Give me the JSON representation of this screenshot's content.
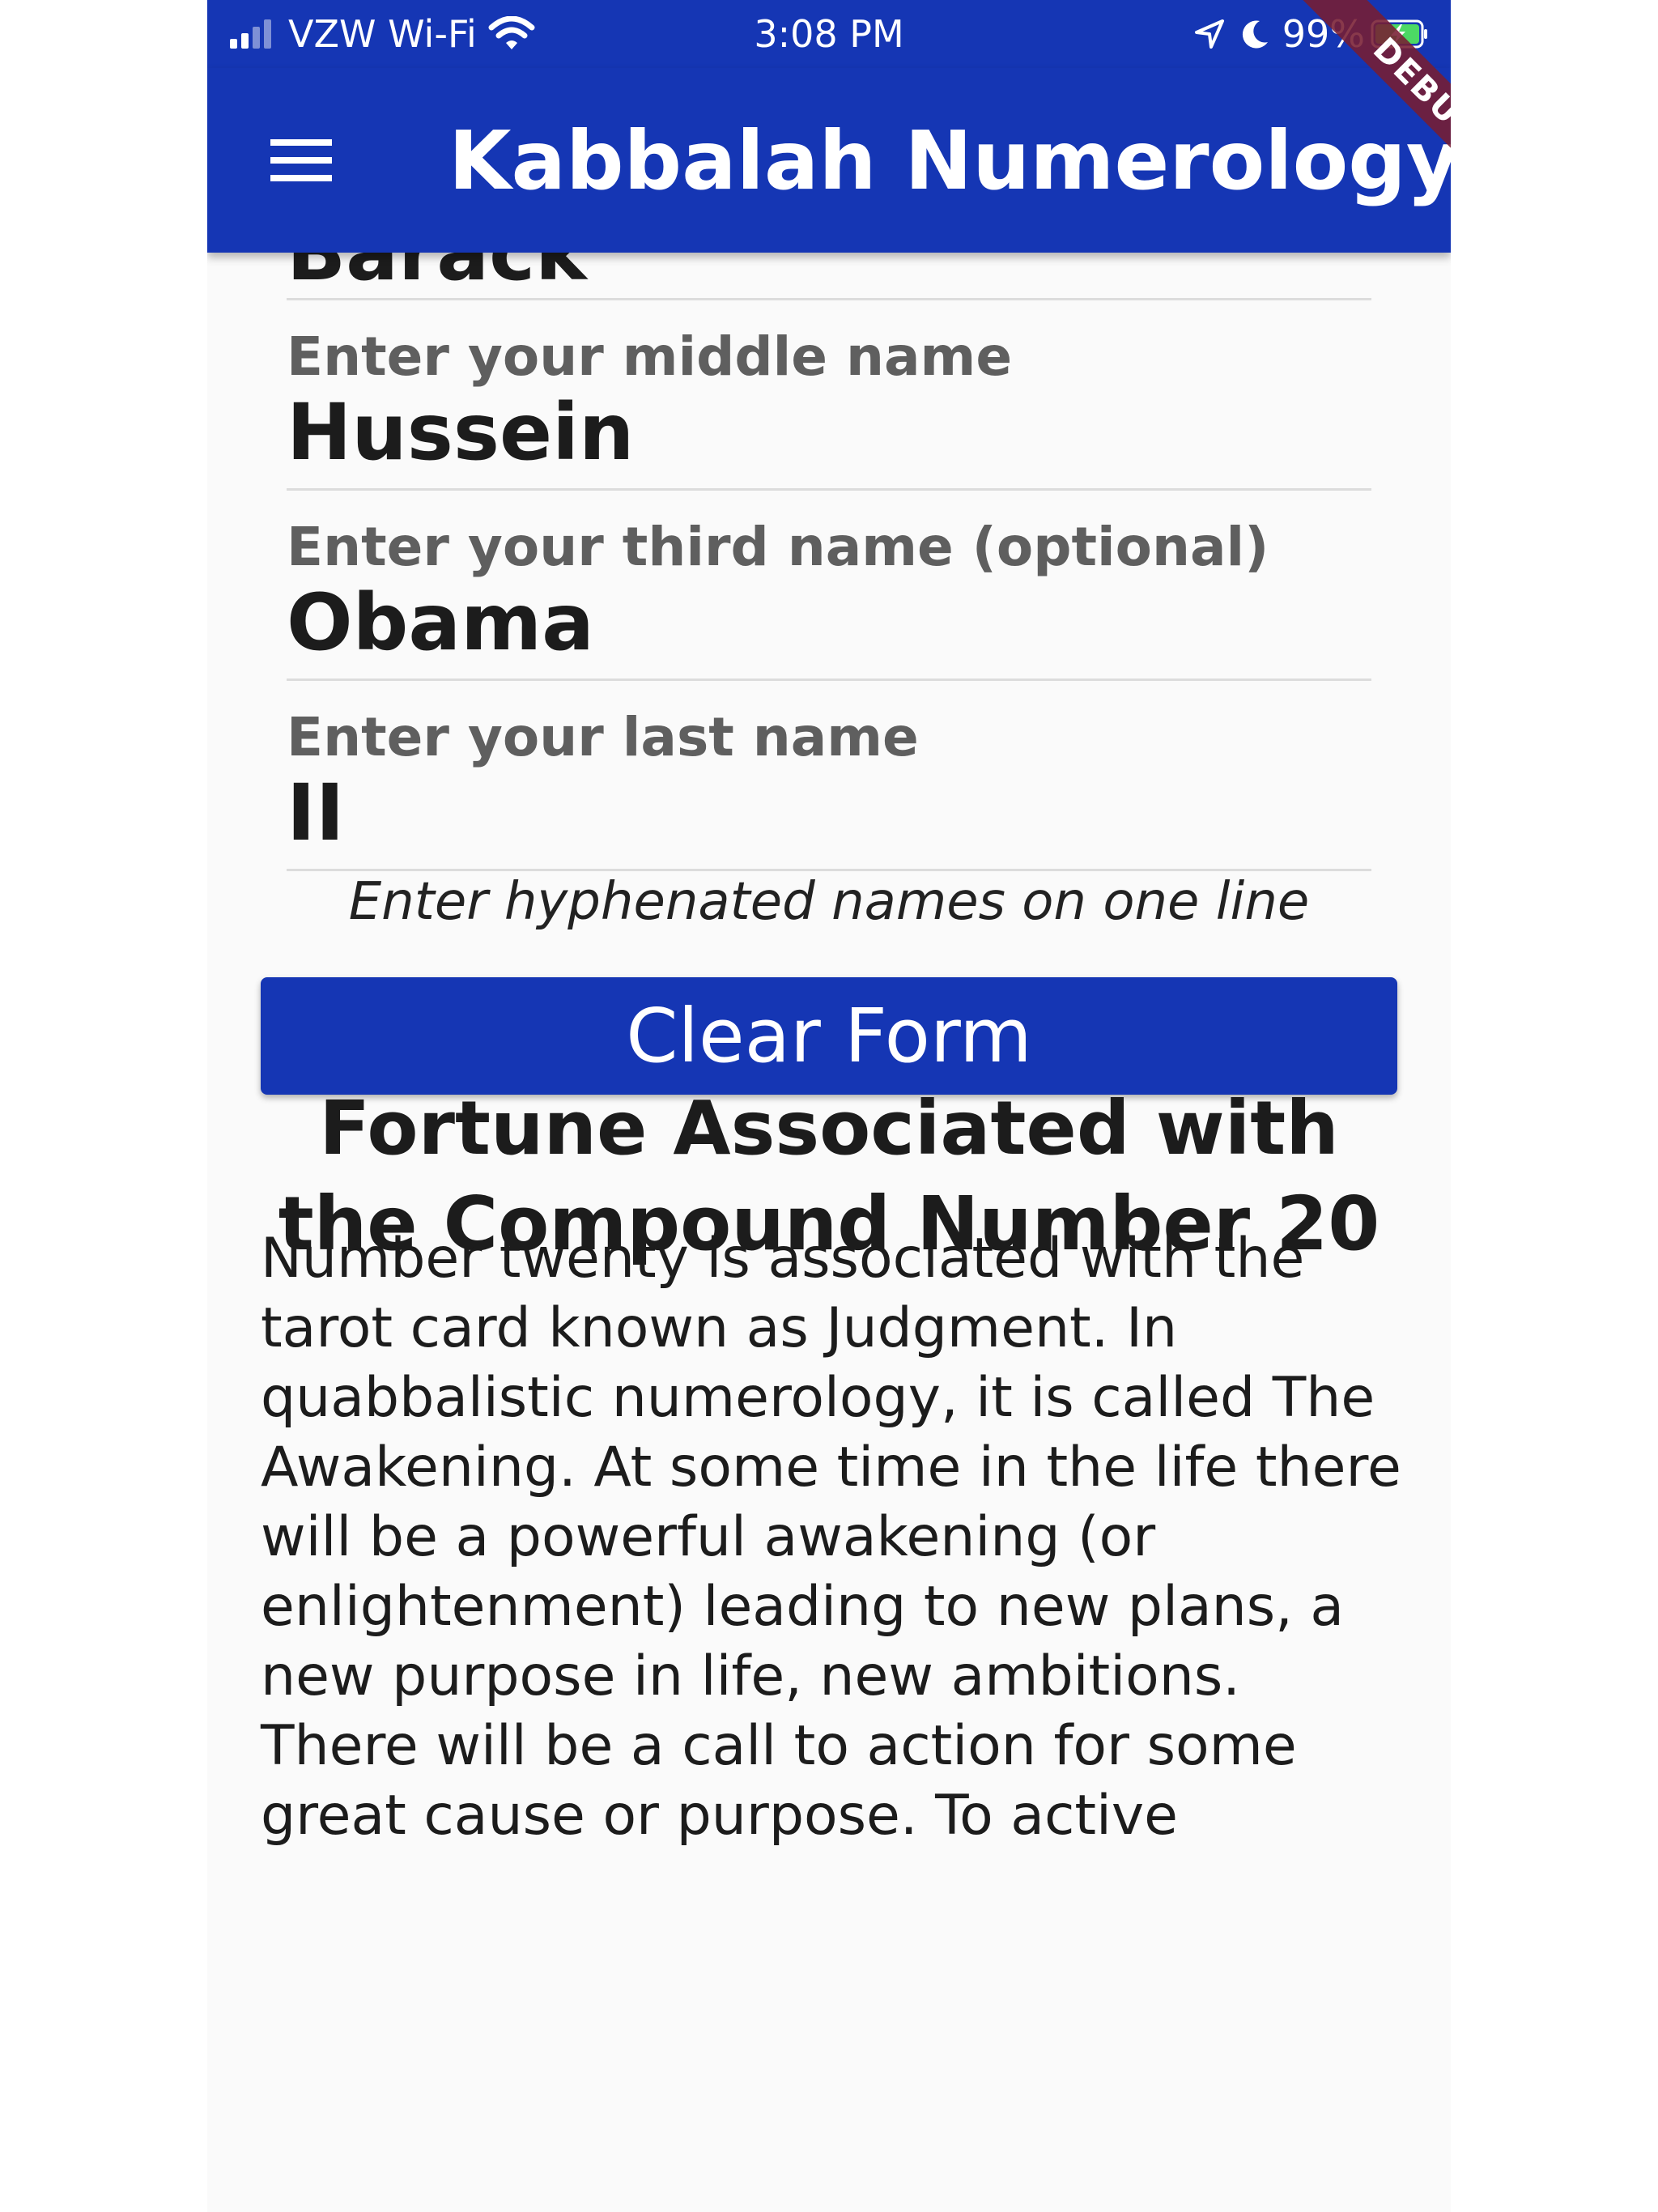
{
  "status_bar": {
    "carrier": "VZW Wi-Fi",
    "time": "3:08 PM",
    "battery": "99%"
  },
  "app_bar": {
    "title": "Kabbalah Numerology",
    "debug_label": "DEBUG"
  },
  "form": {
    "first_name_value": "Barack",
    "middle_name_label": "Enter your middle name",
    "middle_name_value": "Hussein",
    "third_name_label": "Enter your third name (optional)",
    "third_name_value": "Obama",
    "last_name_label": "Enter your last name",
    "last_name_value": "II",
    "hint": "Enter hyphenated names on one line",
    "clear_button_label": "Clear Form"
  },
  "fortune": {
    "title": "Fortune Associated with the Compound Number 20",
    "body": "Number twenty is associated with the tarot card known as Judgment. In quabbalistic numerology, it is called The Awakening. At some time in the life there will be a powerful awakening (or enlightenment) leading to new plans, a new purpose in life, new ambitions. There will be a call to action for some great cause or purpose. To active"
  },
  "colors": {
    "primary": "#1536b4",
    "background": "#fafafa",
    "debug_ribbon": "#781e32"
  },
  "icons": {
    "menu": "hamburger-menu-icon",
    "signal": "cellular-signal-icon",
    "wifi": "wifi-icon",
    "location": "location-arrow-icon",
    "do_not_disturb": "moon-icon",
    "battery": "battery-charging-icon"
  }
}
